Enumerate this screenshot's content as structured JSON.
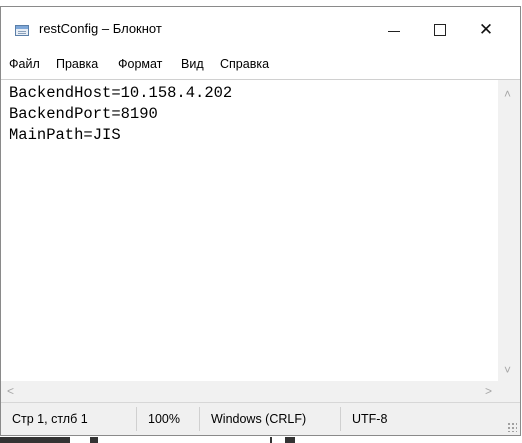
{
  "window": {
    "title": "restConfig – Блокнот",
    "controls": {
      "minimize": "—",
      "maximize": "☐",
      "close": "✕"
    },
    "icon": "notepad-icon"
  },
  "menu": {
    "items": [
      {
        "label": "Файл"
      },
      {
        "label": "Правка"
      },
      {
        "label": "Формат"
      },
      {
        "label": "Вид"
      },
      {
        "label": "Справка"
      }
    ]
  },
  "editor": {
    "lines": [
      "BackendHost=10.158.4.202",
      "BackendPort=8190",
      "MainPath=JIS"
    ]
  },
  "status": {
    "position": "Стр 1, стлб 1",
    "zoom": "100%",
    "line_ending": "Windows (CRLF)",
    "encoding": "UTF-8"
  },
  "scroll_arrows": {
    "up": "˄",
    "down": "˅",
    "left": "<",
    "right": ">"
  }
}
